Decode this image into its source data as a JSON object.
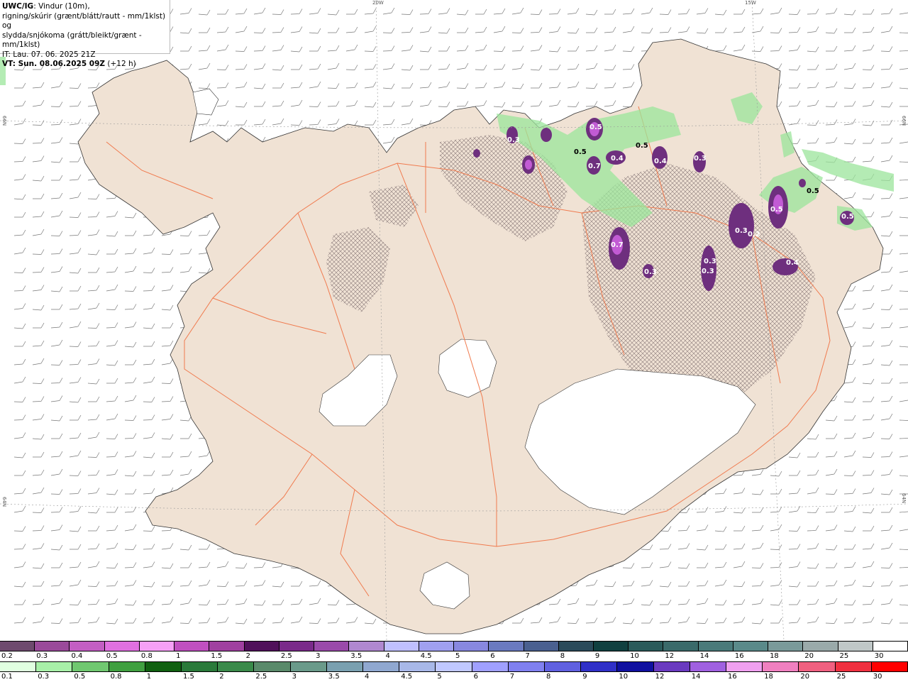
{
  "header": {
    "model": "UWC/IG",
    "line1_rest": ": Vindur (10m),",
    "line2": "rigning/skúrir (grænt/blátt/rautt - mm/1klst) og",
    "line3": "slydda/snjókoma (grátt/bleikt/grænt - mm/1klst)",
    "it": "IT: Lau. 07. 06. 2025 21Z",
    "vt": "VT: Sun. 08.06.2025 09Z",
    "vt_offset": " (+12 h)"
  },
  "edges": {
    "top_20w": "20W",
    "top_15w": "15W",
    "left_66n": "66N",
    "left_64n": "64N",
    "right_66n": "66N",
    "right_64n": "64N"
  },
  "colors": {
    "land": "#f0e2d4",
    "glacier": "#ffffff",
    "road": "#f07a4e",
    "sea": "#ffffff",
    "rain_green": "#9be59b",
    "snow_purple": "#6e2f7e",
    "snow_magenta": "#c25bd4"
  },
  "precip_labels": [
    {
      "text": "0.5",
      "dark": false
    },
    {
      "text": "0.3",
      "dark": false
    },
    {
      "text": "0.4",
      "dark": false
    },
    {
      "text": "0.7",
      "dark": false
    },
    {
      "text": "0.4",
      "dark": false
    },
    {
      "text": "0.3",
      "dark": false
    },
    {
      "text": "0.5",
      "dark": true
    },
    {
      "text": "0.5",
      "dark": true
    },
    {
      "text": "0.5",
      "dark": true
    },
    {
      "text": "0.3",
      "dark": false
    },
    {
      "text": "0.2",
      "dark": false
    },
    {
      "text": "0.5",
      "dark": false
    },
    {
      "text": "0.3",
      "dark": false
    },
    {
      "text": "0.3",
      "dark": false
    },
    {
      "text": "0.4",
      "dark": false
    },
    {
      "text": "0.7",
      "dark": false
    },
    {
      "text": "0.3",
      "dark": false
    },
    {
      "text": "0.5",
      "dark": false
    }
  ],
  "legend_snow": {
    "labels": [
      "0.2",
      "0.3",
      "0.4",
      "0.5",
      "0.8",
      "1",
      "1.5",
      "2",
      "2.5",
      "3",
      "3.5",
      "4",
      "4.5",
      "5",
      "6",
      "7",
      "8",
      "9",
      "10",
      "12",
      "14",
      "16",
      "18",
      "20",
      "25",
      "30"
    ],
    "colors": [
      "#6e4a6e",
      "#9a4a9a",
      "#c35ec3",
      "#e070e0",
      "#f6a0f6",
      "#c050c0",
      "#a040a0",
      "#50105a",
      "#7a2a8a",
      "#9a4aaa",
      "#b088d0",
      "#c0c0ff",
      "#a0a0f0",
      "#8888e0",
      "#6a7ac0",
      "#4a6090",
      "#2a4a5a",
      "#104040",
      "#2a5a5a",
      "#3a6a6a",
      "#4a7a7a",
      "#5a8a8a",
      "#7a9a9a",
      "#9aaaaa",
      "#c0c8c8",
      "#ffffff"
    ]
  },
  "legend_rain": {
    "labels": [
      "0.1",
      "0.3",
      "0.5",
      "0.8",
      "1",
      "1.5",
      "2",
      "2.5",
      "3",
      "3.5",
      "4",
      "4.5",
      "5",
      "6",
      "7",
      "8",
      "9",
      "10",
      "12",
      "14",
      "16",
      "18",
      "20",
      "25",
      "30"
    ],
    "colors": [
      "#e0ffe0",
      "#a8f0a8",
      "#70c870",
      "#40a040",
      "#106010",
      "#2a7a3a",
      "#3a8a4a",
      "#5a8a6a",
      "#6a9a8a",
      "#7aa0b0",
      "#90a8d0",
      "#a8b8e8",
      "#c0c8ff",
      "#a0a0ff",
      "#8080f0",
      "#6060e0",
      "#3030c8",
      "#1010a0",
      "#6a3ac0",
      "#a060e0",
      "#f0a0f0",
      "#f080c0",
      "#f06080",
      "#f03040",
      "#ff0000"
    ]
  }
}
